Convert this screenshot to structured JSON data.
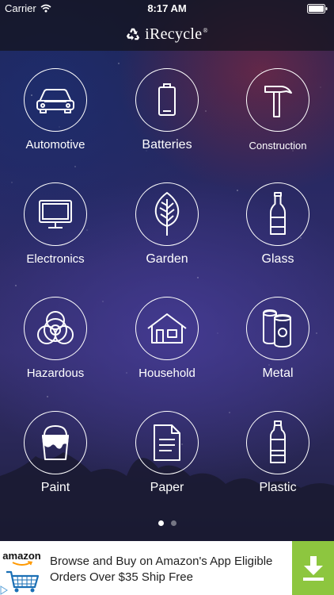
{
  "status_bar": {
    "carrier": "Carrier",
    "time": "8:17 AM"
  },
  "header": {
    "title": "iRecycle",
    "registered": "®"
  },
  "categories": [
    {
      "label": "Automotive",
      "icon": "car-icon"
    },
    {
      "label": "Batteries",
      "icon": "battery-icon"
    },
    {
      "label": "Construction",
      "icon": "hammer-icon"
    },
    {
      "label": "Electronics",
      "icon": "monitor-icon"
    },
    {
      "label": "Garden",
      "icon": "leaf-icon"
    },
    {
      "label": "Glass",
      "icon": "bottle-icon"
    },
    {
      "label": "Hazardous",
      "icon": "biohazard-icon"
    },
    {
      "label": "Household",
      "icon": "house-icon"
    },
    {
      "label": "Metal",
      "icon": "cans-icon"
    },
    {
      "label": "Paint",
      "icon": "paint-bucket-icon"
    },
    {
      "label": "Paper",
      "icon": "document-icon"
    },
    {
      "label": "Plastic",
      "icon": "plastic-bottle-icon"
    }
  ],
  "pager": {
    "pages": 2,
    "current": 1
  },
  "ad": {
    "brand": "amazon",
    "text": "Browse and Buy on Amazon's App Eligible Orders Over $35 Ship Free",
    "colors": {
      "download_bg": "#8dc63f"
    }
  }
}
